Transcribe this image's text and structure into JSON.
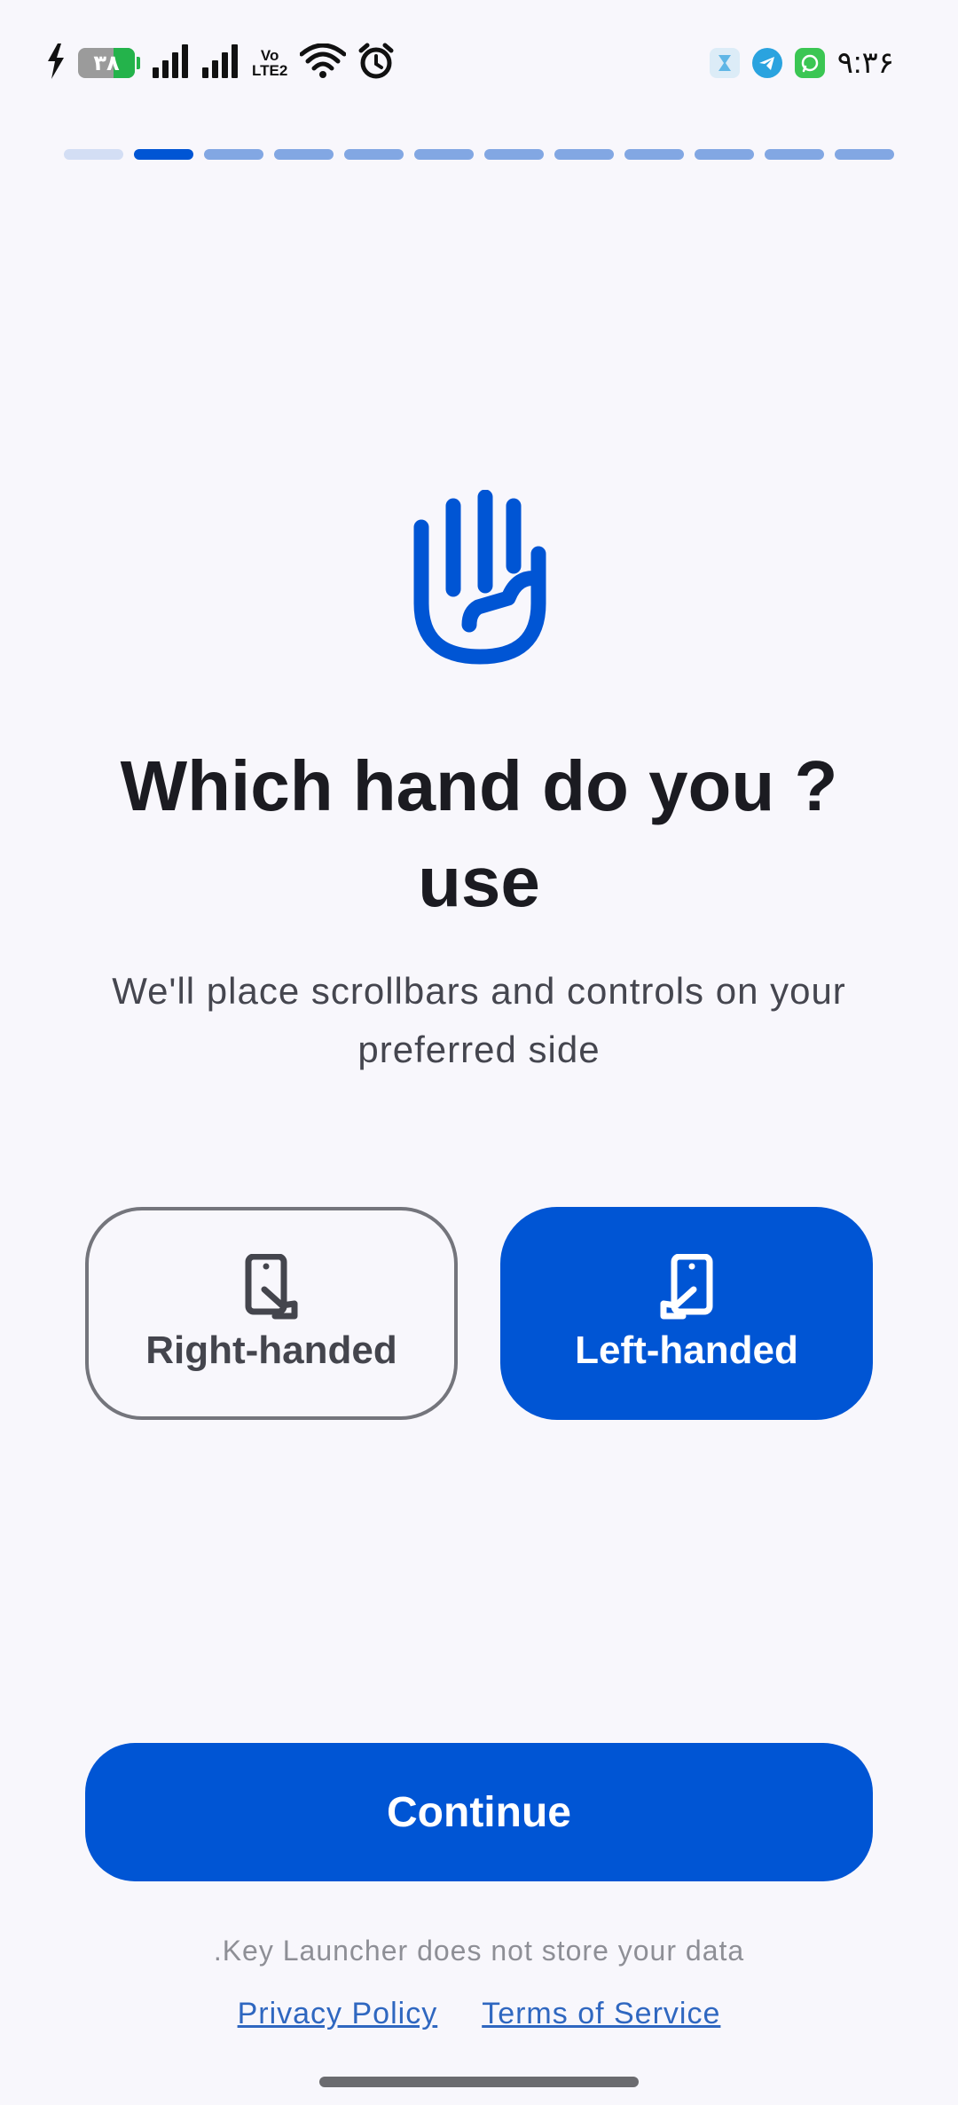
{
  "status_bar": {
    "battery_level": "۳۸",
    "lte_label_top": "Vo",
    "lte_label_bottom": "LTE2",
    "time": "۹:۳۶",
    "icons": [
      "charging-bolt-icon",
      "battery-icon",
      "signal-icon",
      "signal-icon",
      "volte-icon",
      "wifi-icon",
      "alarm-icon",
      "app-notification-icon",
      "telegram-icon",
      "whatsapp-icon"
    ]
  },
  "progress": {
    "total_steps": 12,
    "current_step": 2
  },
  "main": {
    "icon": "raised-hand-icon",
    "title": "Which hand do you ?use",
    "subtitle": "We'll place scrollbars and controls on your preferred side"
  },
  "options": [
    {
      "label": "Right-handed",
      "icon": "phone-right-hand-icon",
      "selected": false
    },
    {
      "label": "Left-handed",
      "icon": "phone-left-hand-icon",
      "selected": true
    }
  ],
  "actions": {
    "continue_label": "Continue"
  },
  "footer": {
    "disclaimer": ".Key Launcher does not store your data",
    "privacy_label": "Privacy Policy",
    "terms_label": "Terms of Service"
  },
  "colors": {
    "background": "#f8f7fc",
    "primary": "#0055d4",
    "progress_pending": "#82a7e3",
    "progress_done": "#d3def4",
    "link": "#2f67c0"
  }
}
